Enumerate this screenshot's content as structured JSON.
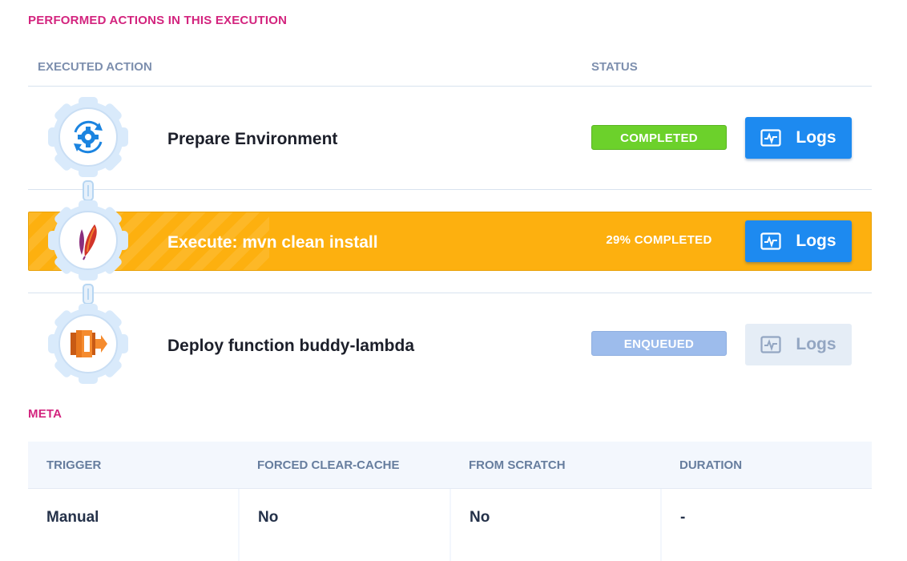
{
  "section_actions": {
    "title": "PERFORMED ACTIONS IN THIS EXECUTION"
  },
  "columns": {
    "executed_action": "EXECUTED ACTION",
    "status": "STATUS"
  },
  "actions": [
    {
      "name": "Prepare Environment",
      "status": "COMPLETED",
      "icon": "gear-sync-icon",
      "logs_label": "Logs"
    },
    {
      "name": "Execute: mvn clean install",
      "status": "29% COMPLETED",
      "progress_percent": 29,
      "icon": "apache-maven-feather-icon",
      "logs_label": "Logs"
    },
    {
      "name": "Deploy function buddy-lambda",
      "status": "ENQUEUED",
      "icon": "aws-lambda-icon",
      "logs_label": "Logs"
    }
  ],
  "section_meta": {
    "title": "META",
    "headers": [
      "TRIGGER",
      "FORCED CLEAR-CACHE",
      "FROM SCRATCH",
      "DURATION"
    ],
    "values": [
      "Manual",
      "No",
      "No",
      "-"
    ]
  },
  "colors": {
    "accent_pink": "#d3247e",
    "completed_green": "#6cd12b",
    "running_orange": "#fdb00f",
    "enqueued_blue": "#9dbcec",
    "button_blue": "#1d8af0"
  }
}
